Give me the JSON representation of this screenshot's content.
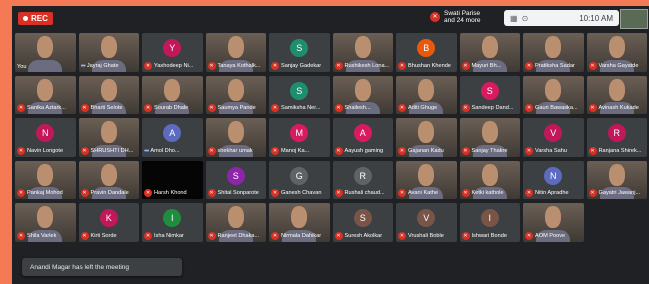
{
  "topbar": {
    "rec_label": "REC",
    "speaker_name": "Swati Parise",
    "speaker_more": "and 24 more",
    "time": "10:10 AM",
    "icons": [
      "grid-view-icon",
      "pin-icon"
    ]
  },
  "participants": [
    {
      "name": "You",
      "kind": "photo"
    },
    {
      "name": "Jayraj Ghate",
      "kind": "photo",
      "talking": true
    },
    {
      "name": "Yashodeep Ni...",
      "kind": "avatar",
      "initial": "Y",
      "color": "#c2185b",
      "muted": true
    },
    {
      "name": "Tanaya Kothalk...",
      "kind": "photo",
      "muted": true
    },
    {
      "name": "Sanjay Gadekar",
      "kind": "avatar",
      "initial": "S",
      "color": "#1e8e6e",
      "muted": true
    },
    {
      "name": "Rushikesh Lona...",
      "kind": "photo",
      "muted": true
    },
    {
      "name": "Bhushan Khende",
      "kind": "avatar",
      "initial": "B",
      "color": "#e8590c",
      "muted": true
    },
    {
      "name": "Mayuri Bh...",
      "kind": "photo",
      "muted": true
    },
    {
      "name": "Pratiksha Sadar",
      "kind": "photo",
      "muted": true
    },
    {
      "name": "Varsha Gayatde",
      "kind": "photo",
      "muted": true
    },
    {
      "name": "Sanika Aztark...",
      "kind": "photo",
      "muted": true
    },
    {
      "name": "Bharti Selote",
      "kind": "photo",
      "muted": true
    },
    {
      "name": "Sourab Dhale",
      "kind": "photo",
      "muted": true
    },
    {
      "name": "Saumya Pande",
      "kind": "photo",
      "muted": true
    },
    {
      "name": "Samiksha Ner...",
      "kind": "avatar",
      "initial": "S",
      "color": "#1e8e6e",
      "muted": true
    },
    {
      "name": "Shailesh...",
      "kind": "photo",
      "muted": true
    },
    {
      "name": "Aditi Ghuge",
      "kind": "photo",
      "muted": true
    },
    {
      "name": "Sandeep Dand...",
      "kind": "avatar",
      "initial": "S",
      "color": "#d81b60",
      "muted": true
    },
    {
      "name": "Gauri Bawaska...",
      "kind": "photo",
      "muted": true
    },
    {
      "name": "Avinash Kukade",
      "kind": "photo",
      "muted": true
    },
    {
      "name": "Navin Longote",
      "kind": "avatar",
      "initial": "N",
      "color": "#c2185b",
      "muted": true
    },
    {
      "name": "SHRUSHTI DH...",
      "kind": "photo",
      "muted": true
    },
    {
      "name": "Amol Dho...",
      "kind": "avatar",
      "initial": "A",
      "color": "#5c6bc0",
      "talking": true
    },
    {
      "name": "shekhar umak",
      "kind": "photo",
      "muted": true
    },
    {
      "name": "Manoj Ka...",
      "kind": "avatar",
      "initial": "M",
      "color": "#d81b60",
      "muted": true
    },
    {
      "name": "Aayush gaming",
      "kind": "avatar",
      "initial": "A",
      "color": "#d81b60",
      "muted": true
    },
    {
      "name": "Gajanan Kadu",
      "kind": "photo",
      "muted": true
    },
    {
      "name": "Sanjay Thakre",
      "kind": "photo",
      "muted": true
    },
    {
      "name": "Varsha Sahu",
      "kind": "avatar",
      "initial": "V",
      "color": "#c2185b",
      "muted": true
    },
    {
      "name": "Ranjana Shirek...",
      "kind": "avatar",
      "initial": "R",
      "color": "#c2185b",
      "muted": true
    },
    {
      "name": "Pankaj Mohod",
      "kind": "photo",
      "muted": true
    },
    {
      "name": "Pravin Dandale",
      "kind": "photo",
      "muted": true
    },
    {
      "name": "Harsh Khond",
      "kind": "dark",
      "muted": true
    },
    {
      "name": "Shital Sonparote",
      "kind": "avatar",
      "initial": "S",
      "color": "#8e24aa",
      "muted": true
    },
    {
      "name": "Ganesh Chavan",
      "kind": "avatar",
      "initial": "G",
      "color": "#5f6368",
      "muted": true
    },
    {
      "name": "Rushali chaud...",
      "kind": "avatar",
      "initial": "R",
      "color": "#5f6368",
      "muted": true
    },
    {
      "name": "Avani Kathe",
      "kind": "photo",
      "muted": true
    },
    {
      "name": "Ketki kathole",
      "kind": "photo",
      "muted": true
    },
    {
      "name": "Nitin Apradhe",
      "kind": "avatar",
      "initial": "N",
      "color": "#5c6bc0",
      "muted": true
    },
    {
      "name": "Gayatri Jawanj...",
      "kind": "photo",
      "muted": true
    },
    {
      "name": "Shila Varlek",
      "kind": "photo",
      "muted": true
    },
    {
      "name": "Kirti Sorde",
      "kind": "avatar",
      "initial": "K",
      "color": "#c2185b",
      "muted": true
    },
    {
      "name": "Isha Nimkar",
      "kind": "avatar",
      "initial": "I",
      "color": "#1e8e3e",
      "muted": true
    },
    {
      "name": "Ranjeet Dhaka...",
      "kind": "photo",
      "muted": true
    },
    {
      "name": "Nirmala Dahikar",
      "kind": "photo",
      "muted": true
    },
    {
      "name": "Suresh Akolkar",
      "kind": "avatar",
      "initial": "S",
      "color": "#795548",
      "muted": true
    },
    {
      "name": "Vrushali Boble",
      "kind": "avatar",
      "initial": "V",
      "color": "#795548",
      "muted": true
    },
    {
      "name": "Ishwari Bonde",
      "kind": "avatar",
      "initial": "I",
      "color": "#795548",
      "muted": true
    },
    {
      "name": "AOM Poove",
      "kind": "photo",
      "muted": true
    }
  ],
  "toast": {
    "text": "Anandi Magar has left the meeting"
  }
}
